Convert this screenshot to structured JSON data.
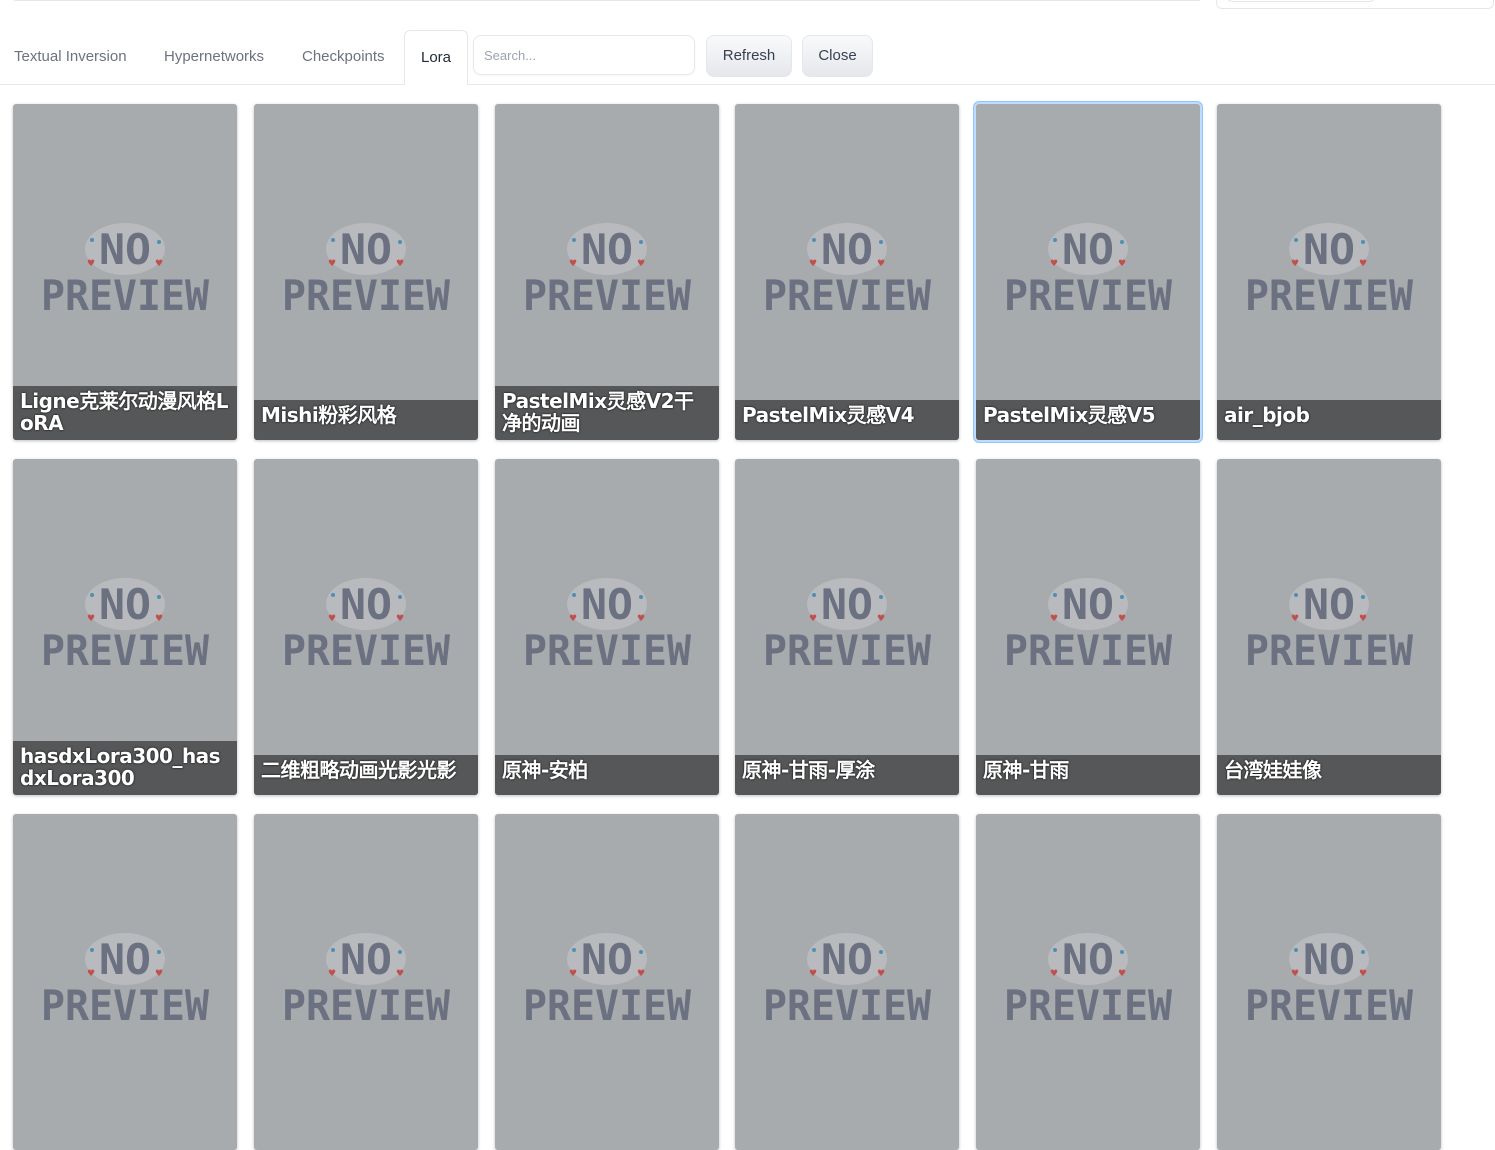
{
  "tabs": [
    {
      "label": "Textual Inversion",
      "active": false
    },
    {
      "label": "Hypernetworks",
      "active": false
    },
    {
      "label": "Checkpoints",
      "active": false
    },
    {
      "label": "Lora",
      "active": true
    }
  ],
  "search": {
    "placeholder": "Search...",
    "value": ""
  },
  "buttons": {
    "refresh": "Refresh",
    "close": "Close"
  },
  "preview_placeholder": {
    "line1": "NO",
    "line2": "PREVIEW"
  },
  "cards": [
    {
      "name": "Ligne克莱尔动漫风格LoRA",
      "selected": false
    },
    {
      "name": "Mishi粉彩风格",
      "selected": false
    },
    {
      "name": "PastelMix灵感V2干净的动画",
      "selected": false
    },
    {
      "name": "PastelMix灵感V4",
      "selected": false
    },
    {
      "name": "PastelMix灵感V5",
      "selected": true
    },
    {
      "name": "air_bjob",
      "selected": false
    },
    {
      "name": "hasdxLora300_hasdxLora300",
      "selected": false
    },
    {
      "name": "二维粗略动画光影光影",
      "selected": false
    },
    {
      "name": "原神-安柏",
      "selected": false
    },
    {
      "name": "原神-甘雨-厚涂",
      "selected": false
    },
    {
      "name": "原神-甘雨",
      "selected": false
    },
    {
      "name": "台湾娃娃像",
      "selected": false
    },
    {
      "name": "",
      "selected": false
    },
    {
      "name": "",
      "selected": false
    },
    {
      "name": "",
      "selected": false
    },
    {
      "name": "",
      "selected": false
    },
    {
      "name": "",
      "selected": false
    },
    {
      "name": "",
      "selected": false
    }
  ],
  "colors": {
    "card_bg": "#a8abae",
    "caption_bg": "#4a4b4c",
    "preview_text": "#6b7180",
    "selected_outline": "#93c5fd"
  }
}
